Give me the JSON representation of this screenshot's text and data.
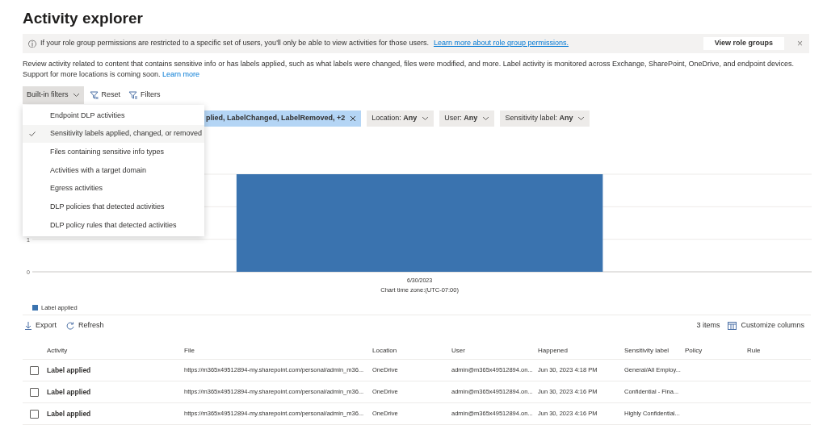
{
  "page_title": "Activity explorer",
  "info_bar": {
    "icon": "ⓘ",
    "message": "If your role group permissions are restricted to a specific set of users, you'll only be able to view activities for those users.",
    "link": "Learn more about role group permissions.",
    "button": "View role groups",
    "close": "×"
  },
  "description": {
    "text": "Review activity related to content that contains sensitive info or has labels applied, such as what labels were changed, files were modified, and more. Label activity is monitored across Exchange, SharePoint, OneDrive, and endpoint devices. Support for more locations is coming soon.",
    "link": "Learn more"
  },
  "toolbar": [
    {
      "kind": "dropdown",
      "label": "Built-in filters",
      "expanded": true
    },
    {
      "kind": "reset",
      "label": "Reset"
    },
    {
      "kind": "filters",
      "label": "Filters"
    }
  ],
  "builtin_filters_menu": [
    {
      "label": "Endpoint DLP activities",
      "selected": false
    },
    {
      "label": "Sensitivity labels applied, changed, or removed",
      "selected": true
    },
    {
      "label": "Files containing sensitive info types",
      "selected": false
    },
    {
      "label": "Activities with a target domain",
      "selected": false
    },
    {
      "label": "Egress activities",
      "selected": false
    },
    {
      "label": "DLP policies that detected activities",
      "selected": false
    },
    {
      "label": "DLP policy rules that detected activities",
      "selected": false
    }
  ],
  "filter_chips": [
    {
      "kind": "active",
      "value": "plied, LabelChanged, LabelRemoved, +2"
    },
    {
      "kind": "dropdown",
      "label": "Location:",
      "value": "Any"
    },
    {
      "kind": "dropdown",
      "label": "User:",
      "value": "Any"
    },
    {
      "kind": "dropdown",
      "label": "Sensitivity label:",
      "value": "Any"
    }
  ],
  "chart": {
    "chart_data": {
      "type": "bar",
      "categories": [
        "6/30/2023"
      ],
      "series": [
        {
          "name": "Label applied",
          "color": "#3a73af",
          "values": [
            3
          ]
        }
      ],
      "ylim": [
        0,
        3
      ],
      "yticks": [
        0,
        1
      ],
      "xlabel": "Chart time zone:(UTC-07:00)"
    }
  },
  "table_toolbar": {
    "export": "Export",
    "refresh": "Refresh",
    "count": "3 items",
    "customize": "Customize columns"
  },
  "table": {
    "columns": [
      "Activity",
      "File",
      "Location",
      "User",
      "Happened",
      "Sensitivity label",
      "Policy",
      "Rule"
    ],
    "rows": [
      {
        "checked": false,
        "cells": [
          "Label applied",
          "https://m365x49512894-my.sharepoint.com/personal/admin_m36...",
          "OneDrive",
          "admin@m365x49512894.on...",
          "Jun 30, 2023 4:18 PM",
          "General/All Employ..."
        ]
      },
      {
        "checked": false,
        "cells": [
          "Label applied",
          "https://m365x49512894-my.sharepoint.com/personal/admin_m36...",
          "OneDrive",
          "admin@m365x49512894.on...",
          "Jun 30, 2023 4:16 PM",
          "Confidential - Fina..."
        ]
      },
      {
        "checked": false,
        "cells": [
          "Label applied",
          "https://m365x49512894-my.sharepoint.com/personal/admin_m36...",
          "OneDrive",
          "admin@m365x49512894.on...",
          "Jun 30, 2023 4:16 PM",
          "Highly Confidential..."
        ]
      }
    ]
  }
}
